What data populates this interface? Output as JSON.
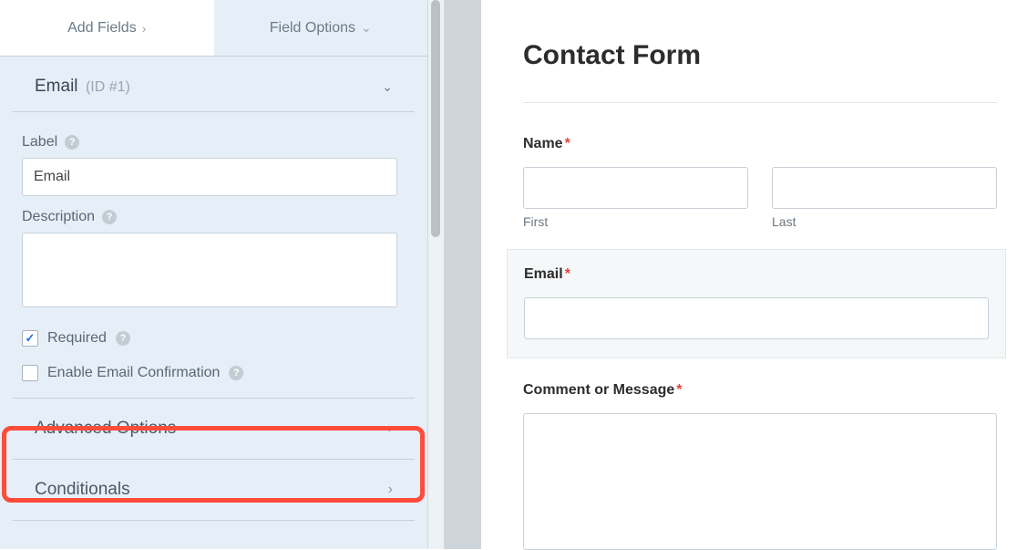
{
  "sidebar": {
    "tabs": {
      "add_fields": "Add Fields",
      "field_options": "Field Options"
    },
    "field": {
      "name": "Email",
      "id_label": "(ID #1)"
    },
    "labels": {
      "label": "Label",
      "description": "Description",
      "required": "Required",
      "enable_confirm": "Enable Email Confirmation",
      "advanced": "Advanced Options",
      "conditionals": "Conditionals"
    },
    "values": {
      "label_value": "Email",
      "description_value": ""
    },
    "checks": {
      "required": true,
      "enable_confirm": false
    }
  },
  "preview": {
    "title": "Contact Form",
    "name_label": "Name",
    "first": "First",
    "last": "Last",
    "email_label": "Email",
    "comment_label": "Comment or Message"
  }
}
